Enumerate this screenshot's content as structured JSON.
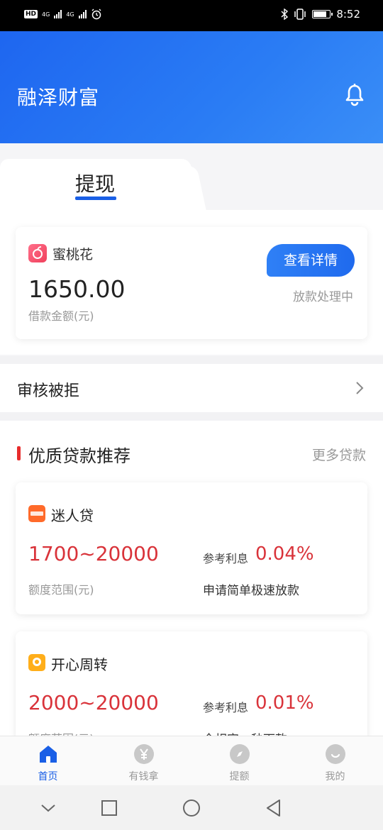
{
  "status_bar": {
    "hd_label": "HD",
    "network1": "4G",
    "network2": "4G",
    "time": "8:52"
  },
  "header": {
    "app_title": "融泽财富",
    "bell_icon": "bell-icon"
  },
  "tabs": [
    {
      "label": "提现",
      "active": true
    }
  ],
  "loan_card": {
    "product_name": "蜜桃花",
    "amount": "1650.00",
    "amount_label": "借款金额(元)",
    "detail_button": "查看详情",
    "status": "放款处理中"
  },
  "reject_row": {
    "label": "审核被拒"
  },
  "recommend": {
    "title": "优质贷款推荐",
    "more_link": "更多贷款",
    "products": [
      {
        "name": "迷人贷",
        "range": "1700~20000",
        "range_label": "额度范围(元)",
        "rate_label": "参考利息",
        "rate": "0.04%",
        "desc": "申请简单极速放款",
        "icon_color": "#ff6a2a"
      },
      {
        "name": "开心周转",
        "range": "2000~20000",
        "range_label": "额度范围(元)",
        "rate_label": "参考利息",
        "rate": "0.01%",
        "desc": "全相审，秒下款",
        "icon_color": "#ffae1a"
      }
    ]
  },
  "bottom_nav": [
    {
      "label": "首页",
      "icon": "home-icon",
      "active": true
    },
    {
      "label": "有钱拿",
      "icon": "yuan-icon",
      "active": false
    },
    {
      "label": "提额",
      "icon": "compass-icon",
      "active": false
    },
    {
      "label": "我的",
      "icon": "smile-icon",
      "active": false
    }
  ],
  "colors": {
    "primary": "#1a5fe6",
    "accent_red": "#d9333a"
  }
}
